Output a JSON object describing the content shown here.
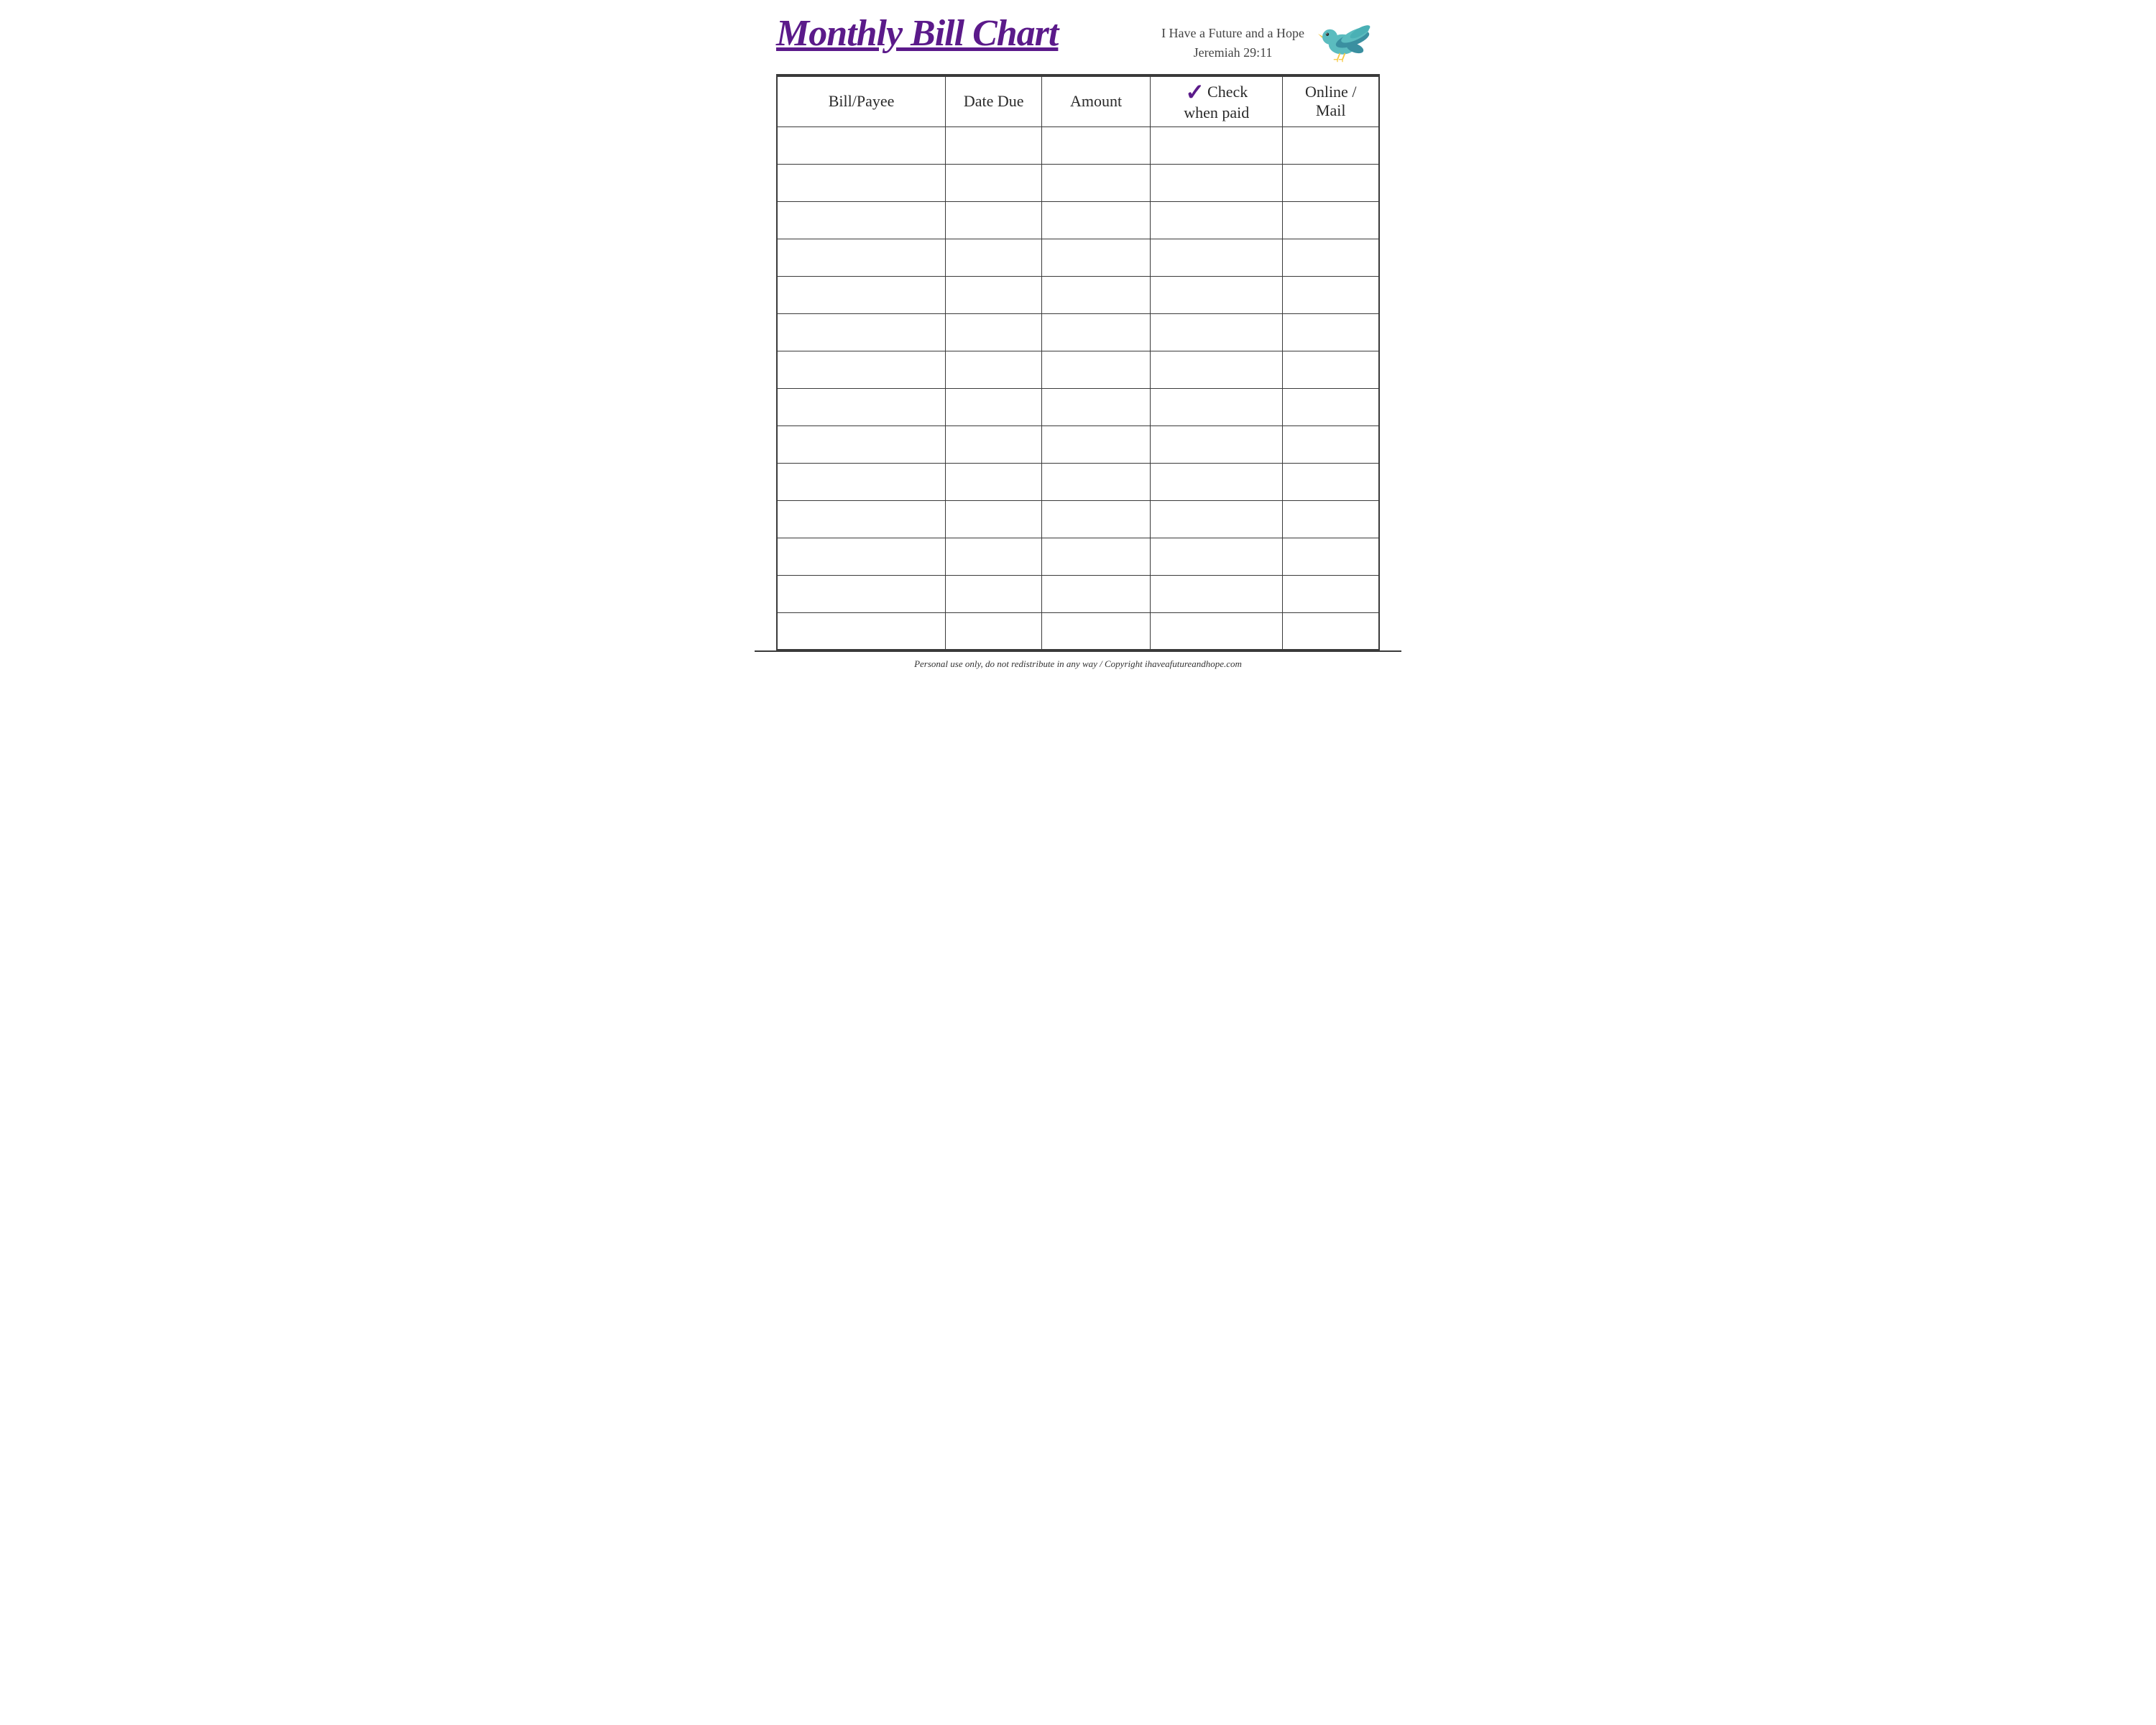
{
  "header": {
    "title": "Monthly Bill Chart",
    "tagline_line1": "I Have a Future and a Hope",
    "tagline_line2": "Jeremiah 29:11"
  },
  "table": {
    "columns": [
      {
        "id": "payee",
        "label": "Bill/Payee"
      },
      {
        "id": "date",
        "label": "Date Due"
      },
      {
        "id": "amount",
        "label": "Amount"
      },
      {
        "id": "check",
        "label_top": "Check",
        "label_bottom": "when paid",
        "has_checkmark": true
      },
      {
        "id": "online",
        "label": "Online / Mail"
      }
    ],
    "row_count": 14
  },
  "footer": {
    "text": "Personal use only, do not redistribute in any way / Copyright ihaveafutureandhope.com"
  },
  "colors": {
    "title": "#5b1a8a",
    "border": "#3a3a3a",
    "checkmark": "#5b1a8a",
    "bird_body": "#5bbcbf",
    "bird_wing": "#3a8fa0",
    "bird_beak": "#f5c842",
    "bird_eye": "#2a2a2a"
  }
}
